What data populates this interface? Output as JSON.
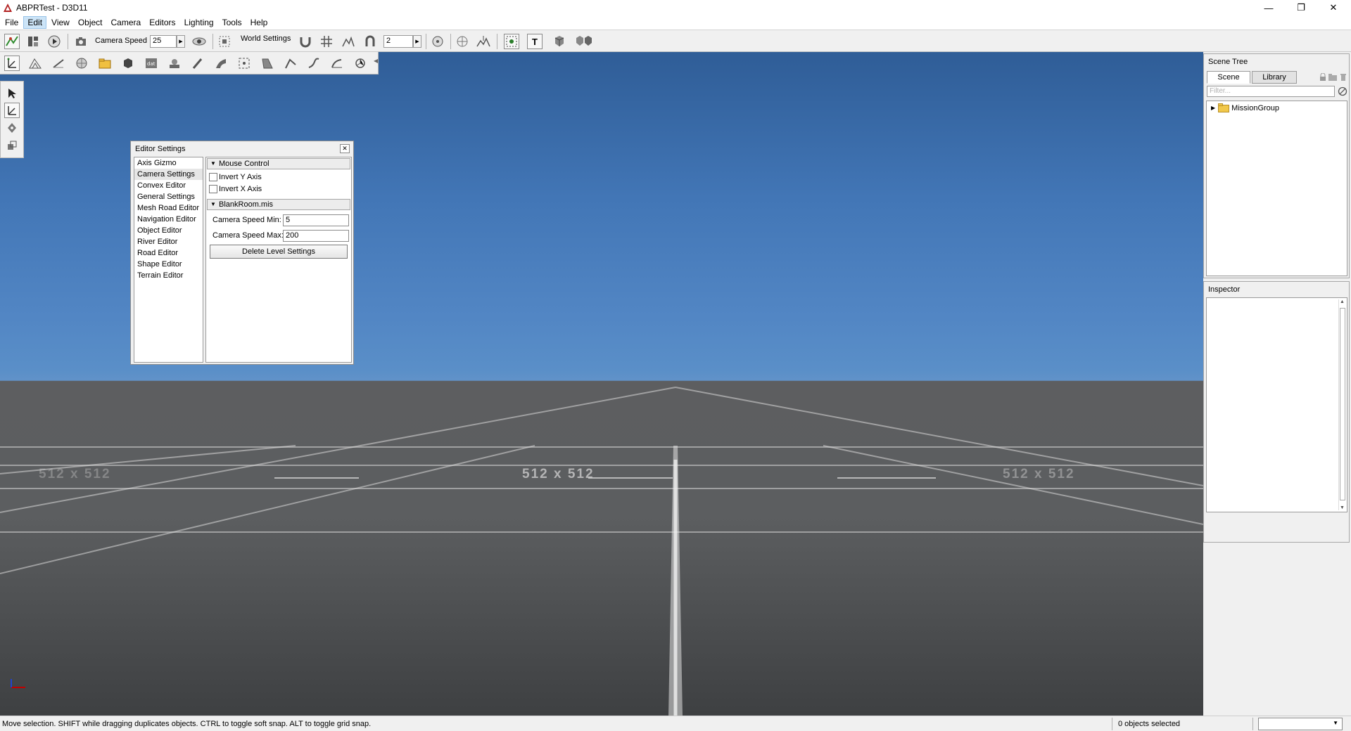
{
  "window": {
    "title": "ABPRTest - D3D11",
    "minimize": "—",
    "restore": "❐",
    "close": "✕"
  },
  "menubar": {
    "items": [
      "File",
      "Edit",
      "View",
      "Object",
      "Camera",
      "Editors",
      "Lighting",
      "Tools",
      "Help"
    ],
    "active": "Edit"
  },
  "toolbar": {
    "camera_speed_label": "Camera Speed",
    "camera_speed_value": "25",
    "world_settings_label": "World Settings",
    "grid_value": "2"
  },
  "viewport": {
    "grid_labels": [
      "512 x 512",
      "512 x 512",
      "512 x 512"
    ]
  },
  "editor_settings": {
    "title": "Editor Settings",
    "categories": [
      "Axis Gizmo",
      "Camera Settings",
      "Convex Editor",
      "General Settings",
      "Mesh Road Editor",
      "Navigation Editor",
      "Object Editor",
      "River Editor",
      "Road Editor",
      "Shape Editor",
      "Terrain Editor"
    ],
    "selected_category": "Camera Settings",
    "mouse_control": {
      "header": "Mouse Control",
      "invert_y": "Invert Y Axis",
      "invert_x": "Invert X Axis"
    },
    "level": {
      "header": "BlankRoom.mis",
      "speed_min_label": "Camera Speed Min:",
      "speed_min_value": "5",
      "speed_max_label": "Camera Speed Max:",
      "speed_max_value": "200",
      "delete_button": "Delete Level Settings"
    }
  },
  "scene_tree": {
    "title": "Scene Tree",
    "tab_scene": "Scene",
    "tab_library": "Library",
    "filter_placeholder": "Filter...",
    "root_item": "MissionGroup"
  },
  "inspector": {
    "title": "Inspector"
  },
  "statusbar": {
    "hint": "Move selection.  SHIFT while dragging duplicates objects.  CTRL to toggle soft snap.  ALT to toggle grid snap.",
    "selection": "0 objects selected"
  },
  "colors": {
    "sky_top": "#2f5d97",
    "sky_horizon": "#6192c9",
    "ground": "#5c5e60",
    "panel_bg": "#f0f0f0"
  }
}
